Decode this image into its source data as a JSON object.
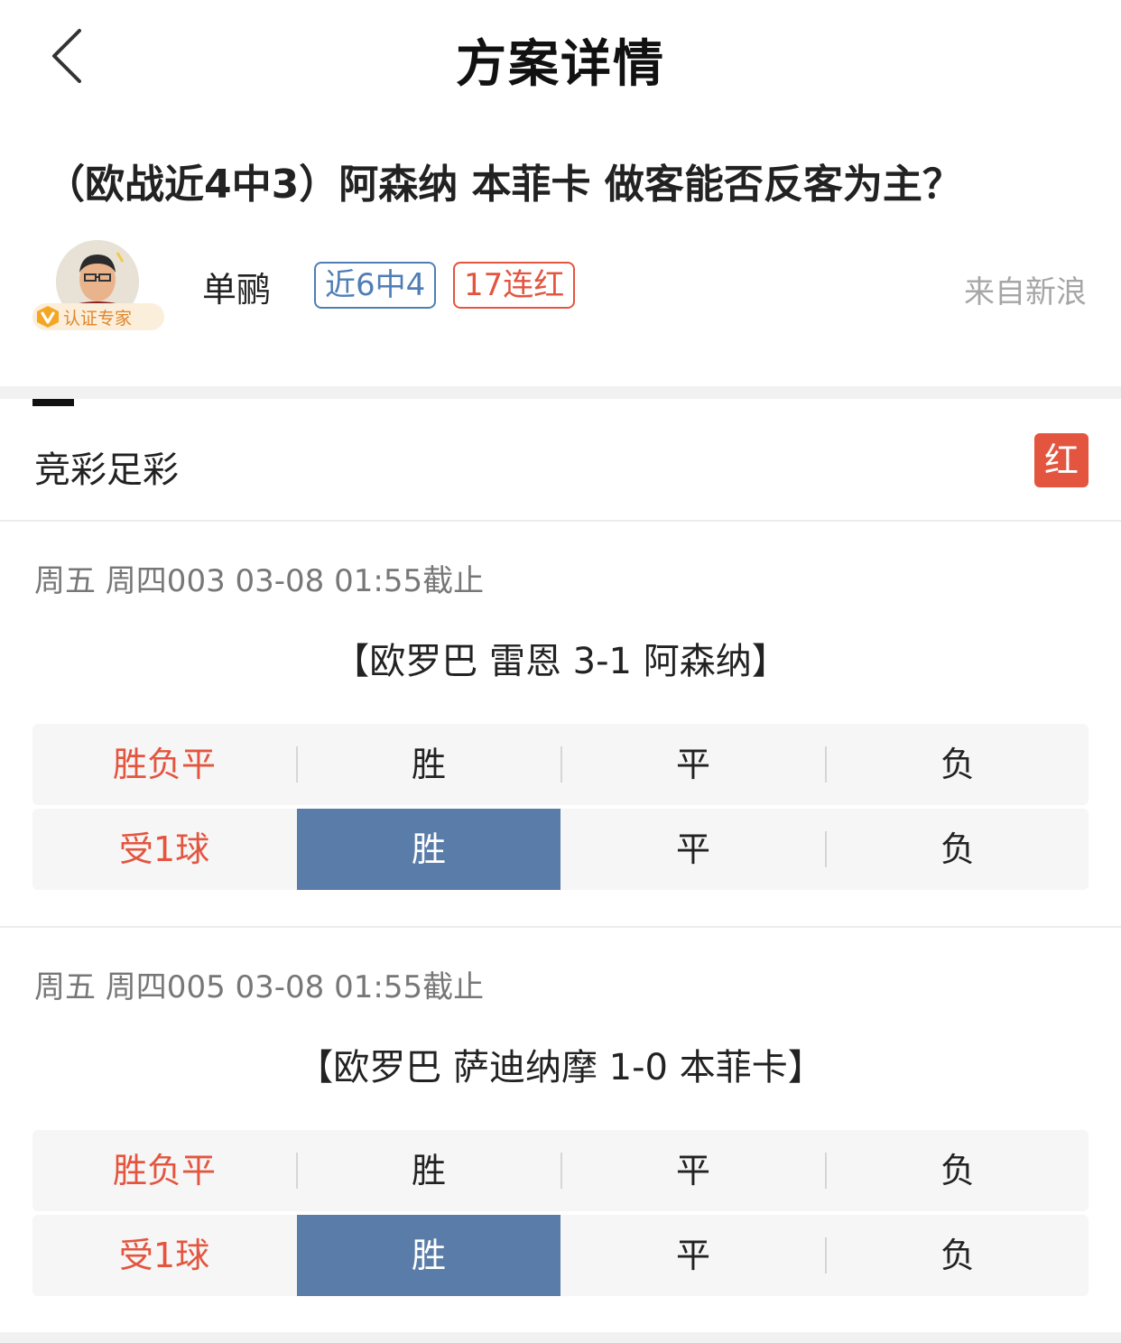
{
  "nav": {
    "title": "方案详情"
  },
  "plan": {
    "title": "（欧战近4中3）阿森纳 本菲卡 做客能否反客为主？"
  },
  "author": {
    "name": "单鹂",
    "cert_label": "认证专家",
    "badges": [
      "近6中4",
      "17连红"
    ],
    "source": "来自新浪"
  },
  "category": {
    "label": "竞彩足彩",
    "result": "红"
  },
  "matches": [
    {
      "meta": "周五 周四003 03-08 01:55截止",
      "title": "【欧罗巴 雷恩 3-1 阿森纳】",
      "rows": [
        {
          "label": "胜负平",
          "options": [
            "胜",
            "平",
            "负"
          ],
          "selected": -1
        },
        {
          "label": "受1球",
          "options": [
            "胜",
            "平",
            "负"
          ],
          "selected": 0
        }
      ]
    },
    {
      "meta": "周五 周四005 03-08 01:55截止",
      "title": "【欧罗巴 萨迪纳摩 1-0 本菲卡】",
      "rows": [
        {
          "label": "胜负平",
          "options": [
            "胜",
            "平",
            "负"
          ],
          "selected": -1
        },
        {
          "label": "受1球",
          "options": [
            "胜",
            "平",
            "负"
          ],
          "selected": 0
        }
      ]
    }
  ],
  "colors": {
    "accent_red": "#e3553f",
    "accent_blue": "#4f7eb6",
    "selected_fill": "#5a7ca8",
    "cert_gold": "#f5a623"
  }
}
